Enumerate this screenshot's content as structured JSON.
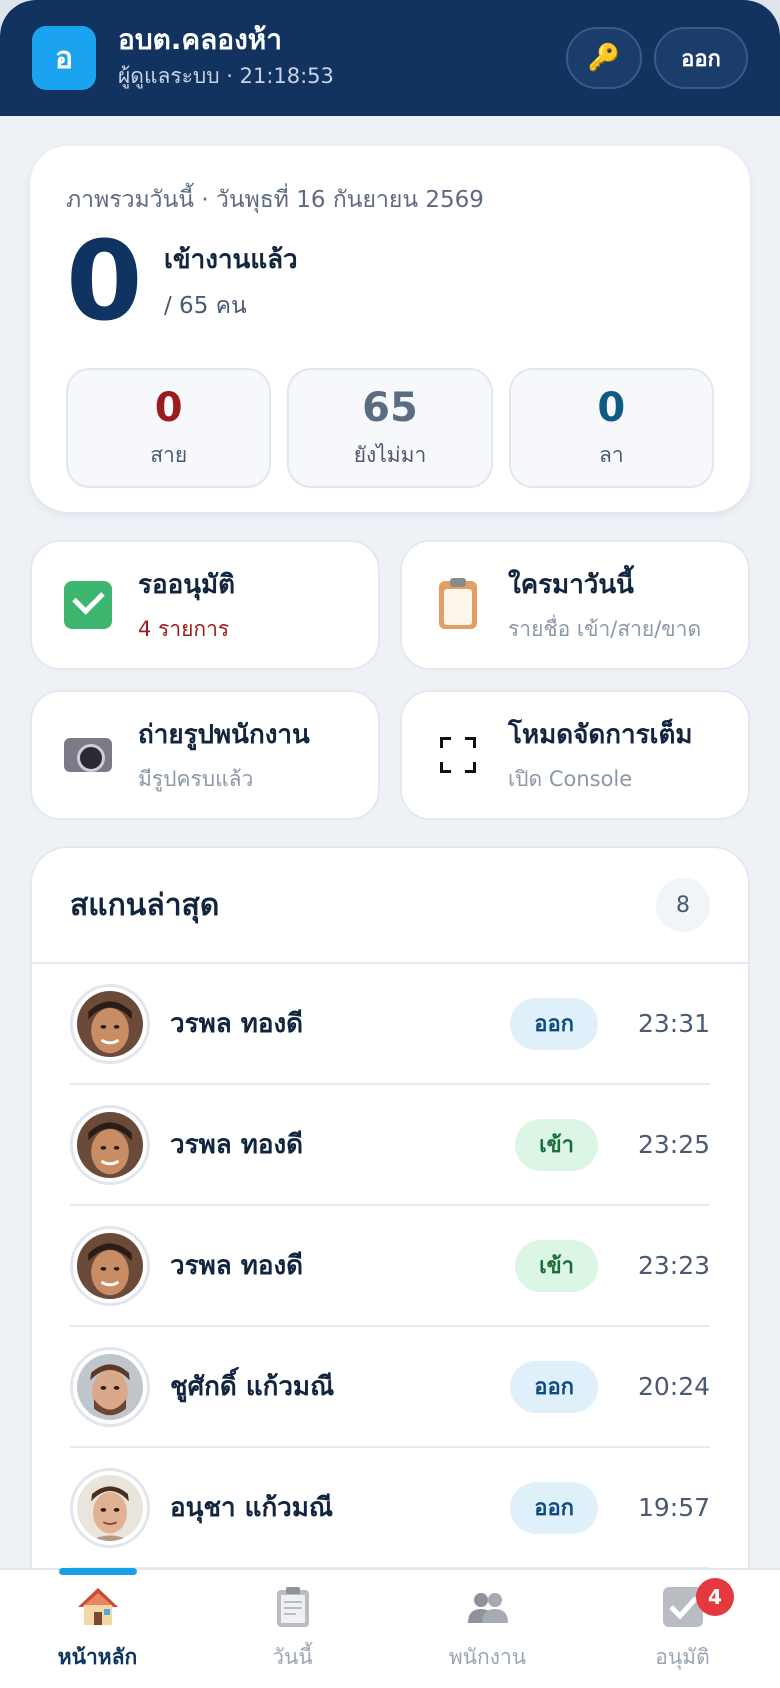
{
  "header": {
    "logo_letter": "อ",
    "title": "อบต.คลองห้า",
    "subtitle": "ผู้ดูแลระบบ · 21:18:53",
    "logout_label": "ออก",
    "key_icon": "🔑"
  },
  "summary": {
    "date_line": "ภาพรวมวันนี้ · วันพุธที่ 16 กันยายน 2569",
    "checked_in_count": "0",
    "checked_in_label": "เข้างานแล้ว",
    "total_line": "/ 65 คน",
    "stats": [
      {
        "value": "0",
        "label": "สาย",
        "color": "#9b1c1c"
      },
      {
        "value": "65",
        "label": "ยังไม่มา",
        "color": "#5b6b80"
      },
      {
        "value": "0",
        "label": "ลา",
        "color": "#0e5a85"
      }
    ]
  },
  "tiles": [
    {
      "title": "รออนุมัติ",
      "subtitle": "4 รายการ",
      "subtitle_color": "#9b1c1c",
      "icon": "check-box-icon"
    },
    {
      "title": "ใครมาวันนี้",
      "subtitle": "รายชื่อ เข้า/สาย/ขาด",
      "icon": "clipboard-icon"
    },
    {
      "title": "ถ่ายรูปพนักงาน",
      "subtitle": "มีรูปครบแล้ว",
      "icon": "camera-icon"
    },
    {
      "title": "โหมดจัดการเต็ม",
      "subtitle": "เปิด Console",
      "icon": "fullscreen-icon"
    }
  ],
  "recent": {
    "title": "สแกนล่าสุด",
    "count": "8",
    "rows": [
      {
        "name": "วรพล ทองดี",
        "status": "ออก",
        "type": "out",
        "time": "23:31"
      },
      {
        "name": "วรพล ทองดี",
        "status": "เข้า",
        "type": "in",
        "time": "23:25"
      },
      {
        "name": "วรพล ทองดี",
        "status": "เข้า",
        "type": "in",
        "time": "23:23"
      },
      {
        "name": "ชูศักดิ์ แก้วมณี",
        "status": "ออก",
        "type": "out",
        "time": "20:24"
      },
      {
        "name": "อนุชา แก้วมณี",
        "status": "ออก",
        "type": "out",
        "time": "19:57"
      }
    ]
  },
  "nav": {
    "items": [
      {
        "label": "หน้าหลัก",
        "icon": "home-icon"
      },
      {
        "label": "วันนี้",
        "icon": "clipboard-icon"
      },
      {
        "label": "พนักงาน",
        "icon": "people-icon"
      },
      {
        "label": "อนุมัติ",
        "icon": "check-box-icon"
      }
    ],
    "approve_badge": "4"
  }
}
